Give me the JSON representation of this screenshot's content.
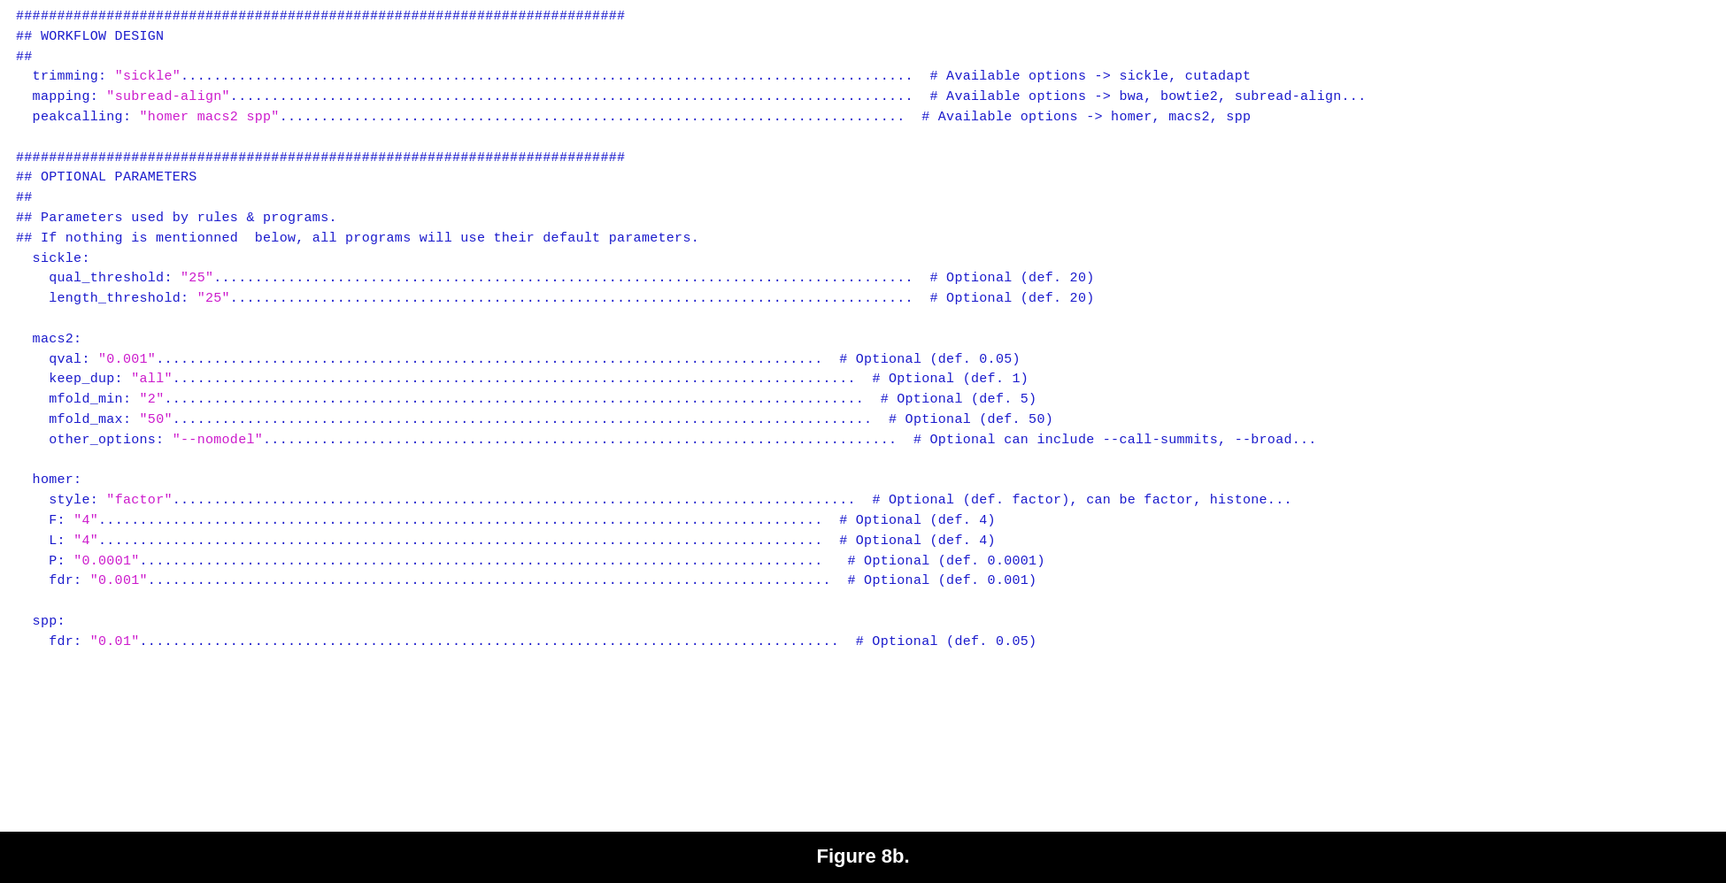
{
  "caption": "Figure 8b.",
  "lines": [
    {
      "id": "l1",
      "content": [
        {
          "t": "##########################################################################",
          "c": "c-hash"
        }
      ]
    },
    {
      "id": "l2",
      "content": [
        {
          "t": "## WORKFLOW DESIGN",
          "c": "c-hash"
        }
      ]
    },
    {
      "id": "l3",
      "content": [
        {
          "t": "##",
          "c": "c-hash"
        }
      ]
    },
    {
      "id": "l4",
      "content": [
        {
          "t": "  trimming: ",
          "c": "c-key"
        },
        {
          "t": "\"sickle\"",
          "c": "c-val"
        },
        {
          "t": ".........................................................................................",
          "c": "c-plain"
        },
        {
          "t": "  # Available options -> sickle, cutadapt",
          "c": "c-comment"
        }
      ]
    },
    {
      "id": "l5",
      "content": [
        {
          "t": "  mapping: ",
          "c": "c-key"
        },
        {
          "t": "\"subread-align\"",
          "c": "c-val"
        },
        {
          "t": "...................................................................................",
          "c": "c-plain"
        },
        {
          "t": "  # Available options -> bwa, bowtie2, subread-align...",
          "c": "c-comment"
        }
      ]
    },
    {
      "id": "l6",
      "content": [
        {
          "t": "  peakcalling: ",
          "c": "c-key"
        },
        {
          "t": "\"homer macs2 spp\"",
          "c": "c-val"
        },
        {
          "t": "............................................................................",
          "c": "c-plain"
        },
        {
          "t": "  # Available options -> homer, macs2, spp",
          "c": "c-comment"
        }
      ]
    },
    {
      "id": "l7",
      "content": [
        {
          "t": " ",
          "c": "c-plain"
        }
      ]
    },
    {
      "id": "l8",
      "content": [
        {
          "t": "##########################################################################",
          "c": "c-hash"
        }
      ]
    },
    {
      "id": "l9",
      "content": [
        {
          "t": "## OPTIONAL PARAMETERS",
          "c": "c-hash"
        }
      ]
    },
    {
      "id": "l10",
      "content": [
        {
          "t": "##",
          "c": "c-hash"
        }
      ]
    },
    {
      "id": "l11",
      "content": [
        {
          "t": "## Parameters used by rules & programs.",
          "c": "c-hash"
        }
      ]
    },
    {
      "id": "l12",
      "content": [
        {
          "t": "## If nothing is mentionned  below, all programs will use their default parameters.",
          "c": "c-hash"
        }
      ]
    },
    {
      "id": "l13",
      "content": [
        {
          "t": "  sickle:",
          "c": "c-key"
        }
      ]
    },
    {
      "id": "l14",
      "content": [
        {
          "t": "    qual_threshold: ",
          "c": "c-key"
        },
        {
          "t": "\"25\"",
          "c": "c-val"
        },
        {
          "t": ".....................................................................................",
          "c": "c-plain"
        },
        {
          "t": "  # Optional (def. 20)",
          "c": "c-comment"
        }
      ]
    },
    {
      "id": "l15",
      "content": [
        {
          "t": "    length_threshold: ",
          "c": "c-key"
        },
        {
          "t": "\"25\"",
          "c": "c-val"
        },
        {
          "t": "...................................................................................",
          "c": "c-plain"
        },
        {
          "t": "  # Optional (def. 20)",
          "c": "c-comment"
        }
      ]
    },
    {
      "id": "l16",
      "content": [
        {
          "t": " ",
          "c": "c-plain"
        }
      ]
    },
    {
      "id": "l17",
      "content": [
        {
          "t": "  macs2:",
          "c": "c-key"
        }
      ]
    },
    {
      "id": "l18",
      "content": [
        {
          "t": "    qval: ",
          "c": "c-key"
        },
        {
          "t": "\"0.001\"",
          "c": "c-val"
        },
        {
          "t": ".................................................................................",
          "c": "c-plain"
        },
        {
          "t": "  # Optional (def. 0.05)",
          "c": "c-comment"
        }
      ]
    },
    {
      "id": "l19",
      "content": [
        {
          "t": "    keep_dup: ",
          "c": "c-key"
        },
        {
          "t": "\"all\"",
          "c": "c-val"
        },
        {
          "t": "...................................................................................",
          "c": "c-plain"
        },
        {
          "t": "  # Optional (def. 1)",
          "c": "c-comment"
        }
      ]
    },
    {
      "id": "l20",
      "content": [
        {
          "t": "    mfold_min: ",
          "c": "c-key"
        },
        {
          "t": "\"2\"",
          "c": "c-val"
        },
        {
          "t": ".....................................................................................",
          "c": "c-plain"
        },
        {
          "t": "  # Optional (def. 5)",
          "c": "c-comment"
        }
      ]
    },
    {
      "id": "l21",
      "content": [
        {
          "t": "    mfold_max: ",
          "c": "c-key"
        },
        {
          "t": "\"50\"",
          "c": "c-val"
        },
        {
          "t": ".....................................................................................",
          "c": "c-plain"
        },
        {
          "t": "  # Optional (def. 50)",
          "c": "c-comment"
        }
      ]
    },
    {
      "id": "l22",
      "content": [
        {
          "t": "    other_options: ",
          "c": "c-key"
        },
        {
          "t": "\"--nomodel\"",
          "c": "c-val"
        },
        {
          "t": ".............................................................................",
          "c": "c-plain"
        },
        {
          "t": "  # Optional can include --call-summits, --broad...",
          "c": "c-comment"
        }
      ]
    },
    {
      "id": "l23",
      "content": [
        {
          "t": " ",
          "c": "c-plain"
        }
      ]
    },
    {
      "id": "l24",
      "content": [
        {
          "t": "  homer:",
          "c": "c-key"
        }
      ]
    },
    {
      "id": "l25",
      "content": [
        {
          "t": "    style: ",
          "c": "c-key"
        },
        {
          "t": "\"factor\"",
          "c": "c-val"
        },
        {
          "t": "...................................................................................",
          "c": "c-plain"
        },
        {
          "t": "  # Optional (def. factor), can be factor, histone...",
          "c": "c-comment"
        }
      ]
    },
    {
      "id": "l26",
      "content": [
        {
          "t": "    F: ",
          "c": "c-key"
        },
        {
          "t": "\"4\"",
          "c": "c-val"
        },
        {
          "t": "........................................................................................",
          "c": "c-plain"
        },
        {
          "t": "  # Optional (def. 4)",
          "c": "c-comment"
        }
      ]
    },
    {
      "id": "l27",
      "content": [
        {
          "t": "    L: ",
          "c": "c-key"
        },
        {
          "t": "\"4\"",
          "c": "c-val"
        },
        {
          "t": "........................................................................................",
          "c": "c-plain"
        },
        {
          "t": "  # Optional (def. 4)",
          "c": "c-comment"
        }
      ]
    },
    {
      "id": "l28",
      "content": [
        {
          "t": "    P: ",
          "c": "c-key"
        },
        {
          "t": "\"0.0001\"",
          "c": "c-val"
        },
        {
          "t": "...................................................................................",
          "c": "c-plain"
        },
        {
          "t": "   # Optional (def. 0.0001)",
          "c": "c-comment"
        }
      ]
    },
    {
      "id": "l29",
      "content": [
        {
          "t": "    fdr: ",
          "c": "c-key"
        },
        {
          "t": "\"0.001\"",
          "c": "c-val"
        },
        {
          "t": "...................................................................................",
          "c": "c-plain"
        },
        {
          "t": "  # Optional (def. 0.001)",
          "c": "c-comment"
        }
      ]
    },
    {
      "id": "l30",
      "content": [
        {
          "t": " ",
          "c": "c-plain"
        }
      ]
    },
    {
      "id": "l31",
      "content": [
        {
          "t": "  spp:",
          "c": "c-key"
        }
      ]
    },
    {
      "id": "l32",
      "content": [
        {
          "t": "    fdr: ",
          "c": "c-key"
        },
        {
          "t": "\"0.01\"",
          "c": "c-val"
        },
        {
          "t": ".....................................................................................",
          "c": "c-plain"
        },
        {
          "t": "  # Optional (def. 0.05)",
          "c": "c-comment"
        }
      ]
    }
  ]
}
